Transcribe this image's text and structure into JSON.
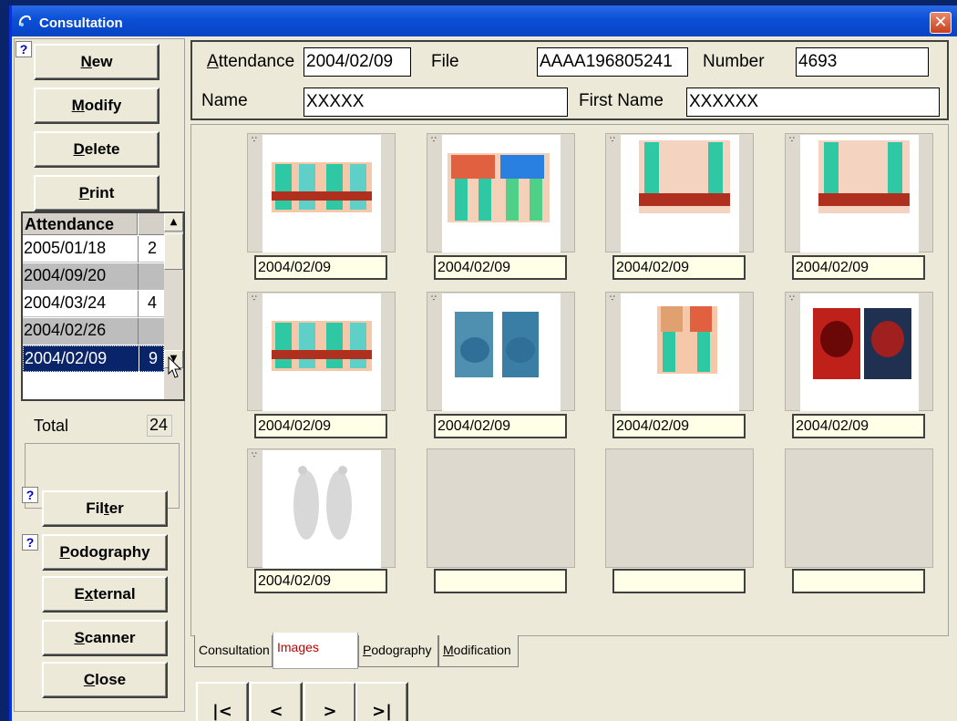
{
  "window": {
    "title": "Consultation",
    "close_label": "✕"
  },
  "toolbar": {
    "help_label": "?",
    "new_label": "New",
    "new_key": "N",
    "new_rest": "ew",
    "modify_label": "Modify",
    "modify_key": "M",
    "modify_rest": "odify",
    "delete_label": "Delete",
    "delete_key": "D",
    "delete_rest": "elete",
    "print_label": "Print",
    "print_key": "P",
    "print_rest": "rint"
  },
  "attendance_list": {
    "header": "Attendance",
    "rows": [
      {
        "date": "2005/01/18",
        "count": "2",
        "style": "normal"
      },
      {
        "date": "2004/09/20",
        "count": "",
        "style": "grey"
      },
      {
        "date": "2004/03/24",
        "count": "4",
        "style": "normal"
      },
      {
        "date": "2004/02/26",
        "count": "",
        "style": "grey"
      },
      {
        "date": "2004/02/09",
        "count": "9",
        "style": "selected"
      }
    ],
    "total_label": "Total",
    "total_value": "24"
  },
  "side_buttons": {
    "filter_pre": "Fil",
    "filter_key": "t",
    "filter_post": "er",
    "podography_key": "P",
    "podography_rest": "odography",
    "external_pre": "E",
    "external_key": "x",
    "external_post": "ternal",
    "scanner_key": "S",
    "scanner_rest": "canner",
    "close_key": "C",
    "close_rest": "lose"
  },
  "header": {
    "attendance_label_key": "A",
    "attendance_label_rest": "ttendance",
    "attendance_value": "2004/02/09",
    "file_label": "File",
    "file_value": "AAAA196805241",
    "number_label": "Number",
    "number_value": "4693",
    "name_label": "Name",
    "name_value": "XXXXX",
    "first_name_label": "First Name",
    "first_name_value": "XXXXXX"
  },
  "images": [
    {
      "date": "2004/02/09",
      "kind": "thermo-legs-front"
    },
    {
      "date": "2004/02/09",
      "kind": "thermo-knees"
    },
    {
      "date": "2004/02/09",
      "kind": "thermo-legs-back"
    },
    {
      "date": "2004/02/09",
      "kind": "thermo-legs-back"
    },
    {
      "date": "2004/02/09",
      "kind": "thermo-legs-front"
    },
    {
      "date": "2004/02/09",
      "kind": "knees-blue"
    },
    {
      "date": "2004/02/09",
      "kind": "thermo-knees-small"
    },
    {
      "date": "2004/02/09",
      "kind": "thermo-feet-red"
    },
    {
      "date": "2004/02/09",
      "kind": "footprint"
    },
    {
      "date": "",
      "kind": "empty"
    },
    {
      "date": "",
      "kind": "empty"
    },
    {
      "date": "",
      "kind": "empty"
    }
  ],
  "tabs": [
    {
      "label": "Consultation",
      "active": false
    },
    {
      "label": "Images",
      "active": true
    },
    {
      "label": "Podography",
      "active": false
    },
    {
      "label": "Modification",
      "active": false
    }
  ],
  "nav": {
    "first": "|<",
    "prev": "<",
    "next": ">",
    "last": ">|"
  },
  "colors": {
    "title_bar": "#0a4fd6",
    "selection": "#0a246a",
    "active_tab_text": "#c00000"
  }
}
